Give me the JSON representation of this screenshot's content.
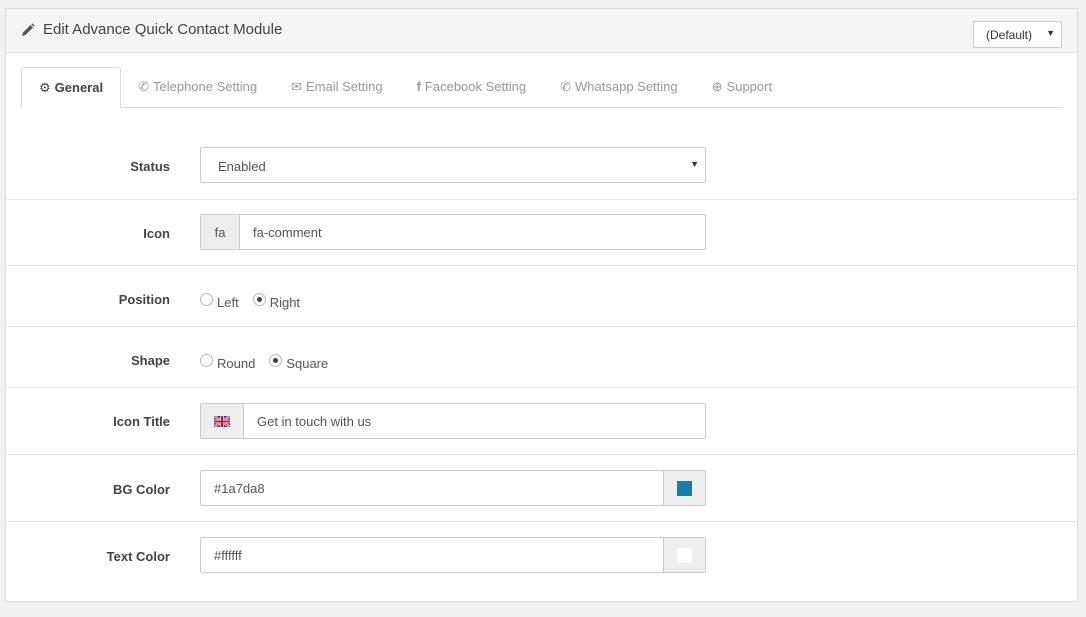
{
  "header": {
    "title": "Edit Advance Quick Contact Module",
    "store_select": "(Default)"
  },
  "tabs": [
    {
      "label": "General",
      "icon": "gear-icon"
    },
    {
      "label": "Telephone Setting",
      "icon": "phone-icon"
    },
    {
      "label": "Email Setting",
      "icon": "envelope-icon"
    },
    {
      "label": "Facebook Setting",
      "icon": "facebook-icon"
    },
    {
      "label": "Whatsapp Setting",
      "icon": "whatsapp-icon"
    },
    {
      "label": "Support",
      "icon": "lifebuoy-icon"
    }
  ],
  "form": {
    "status": {
      "label": "Status",
      "value": "Enabled"
    },
    "icon": {
      "label": "Icon",
      "prefix": "fa",
      "value": "fa-comment"
    },
    "position": {
      "label": "Position",
      "options": [
        "Left",
        "Right"
      ],
      "selected": "Right"
    },
    "shape": {
      "label": "Shape",
      "options": [
        "Round",
        "Square"
      ],
      "selected": "Square"
    },
    "icon_title": {
      "label": "Icon Title",
      "value": "Get in touch with us",
      "flag": "uk-flag-icon"
    },
    "bg_color": {
      "label": "BG Color",
      "value": "#1a7da8"
    },
    "text_color": {
      "label": "Text Color",
      "value": "#ffffff"
    }
  }
}
